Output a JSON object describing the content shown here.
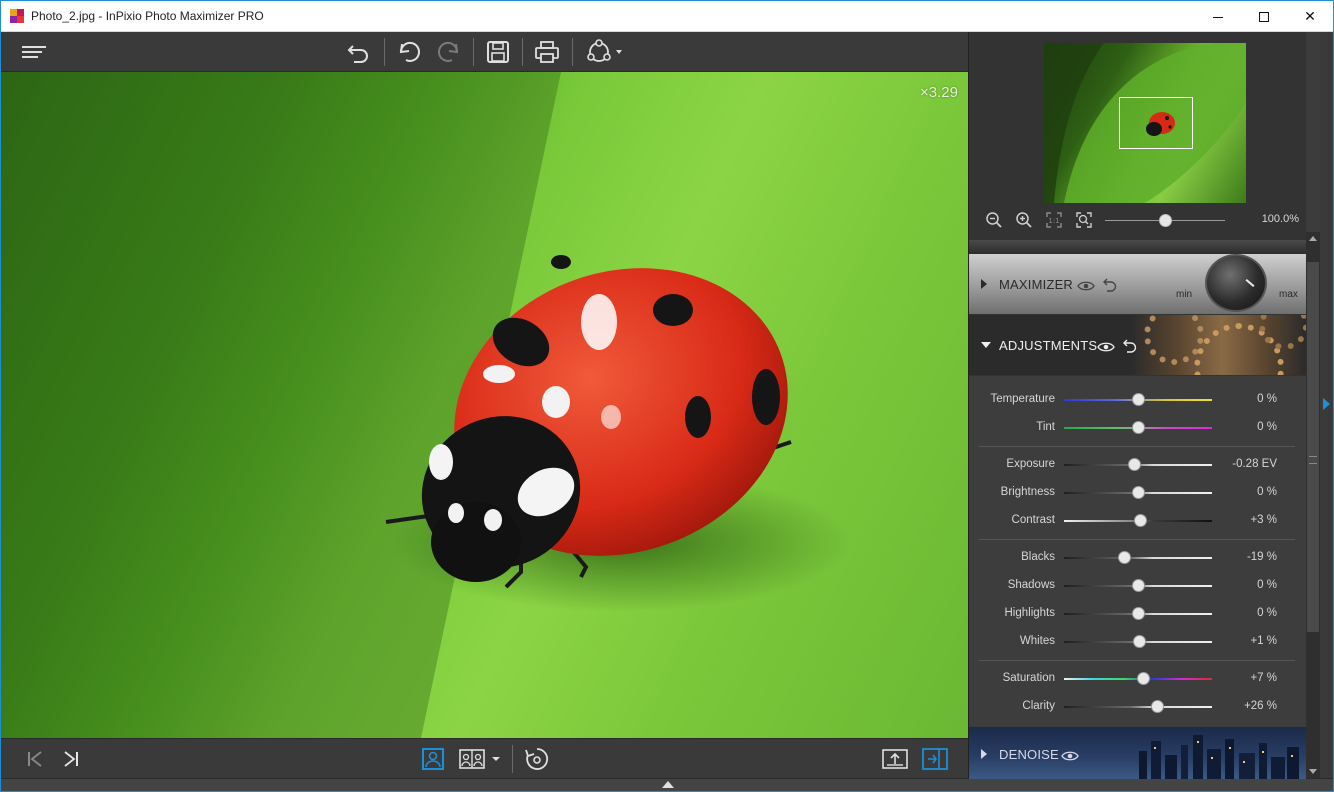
{
  "window": {
    "title": "Photo_2.jpg - InPixio Photo Maximizer PRO",
    "controls": [
      "minimize",
      "maximize",
      "close"
    ],
    "close_glyph": "✕"
  },
  "toolbar": {
    "icons": [
      "menu-icon",
      "undo-all-icon",
      "undo-icon",
      "redo-icon",
      "save-icon",
      "print-icon",
      "share-icon"
    ]
  },
  "canvas": {
    "zoom_factor": "×3.29"
  },
  "navigator": {
    "zoom_value": "100.0%",
    "zoom_slider_fraction": 0.5,
    "icons": [
      "zoom-out-icon",
      "zoom-in-icon",
      "fit-icon",
      "actual-size-icon"
    ]
  },
  "sections": {
    "maximizer": {
      "label": "MAXIMIZER",
      "dial_min": "min",
      "dial_max": "max",
      "expanded": false
    },
    "adjustments": {
      "label": "ADJUSTMENTS",
      "expanded": true
    },
    "denoise": {
      "label": "DENOISE",
      "expanded": false
    }
  },
  "adjustments": [
    {
      "id": "temperature",
      "label": "Temperature",
      "value": "0 %",
      "fraction": 0.5,
      "track": "temperature"
    },
    {
      "id": "tint",
      "label": "Tint",
      "value": "0 %",
      "fraction": 0.5,
      "track": "tint"
    },
    {
      "id": "exposure",
      "label": "Exposure",
      "value": "-0.28 EV",
      "fraction": 0.47,
      "track": "gray"
    },
    {
      "id": "brightness",
      "label": "Brightness",
      "value": "0 %",
      "fraction": 0.5,
      "track": "gray"
    },
    {
      "id": "contrast",
      "label": "Contrast",
      "value": "+3 %",
      "fraction": 0.515,
      "track": "contrast"
    },
    {
      "id": "blacks",
      "label": "Blacks",
      "value": "-19 %",
      "fraction": 0.405,
      "track": "gray"
    },
    {
      "id": "shadows",
      "label": "Shadows",
      "value": "0 %",
      "fraction": 0.5,
      "track": "gray"
    },
    {
      "id": "highlights",
      "label": "Highlights",
      "value": "0 %",
      "fraction": 0.5,
      "track": "gray"
    },
    {
      "id": "whites",
      "label": "Whites",
      "value": "+1 %",
      "fraction": 0.505,
      "track": "gray"
    },
    {
      "id": "saturation",
      "label": "Saturation",
      "value": "+7 %",
      "fraction": 0.535,
      "track": "saturation"
    },
    {
      "id": "clarity",
      "label": "Clarity",
      "value": "+26 %",
      "fraction": 0.63,
      "track": "gray"
    }
  ],
  "bottombar": {
    "icons": [
      "first-image-icon",
      "next-image-icon",
      "single-view-icon",
      "compare-view-icon",
      "compare-dropdown-icon",
      "rotate-icon",
      "export-icon",
      "toggle-panel-icon"
    ]
  },
  "colors": {
    "accent": "#1e8fd6",
    "panel_bg": "#333333",
    "toolbar_bg": "#3a3a3a"
  }
}
